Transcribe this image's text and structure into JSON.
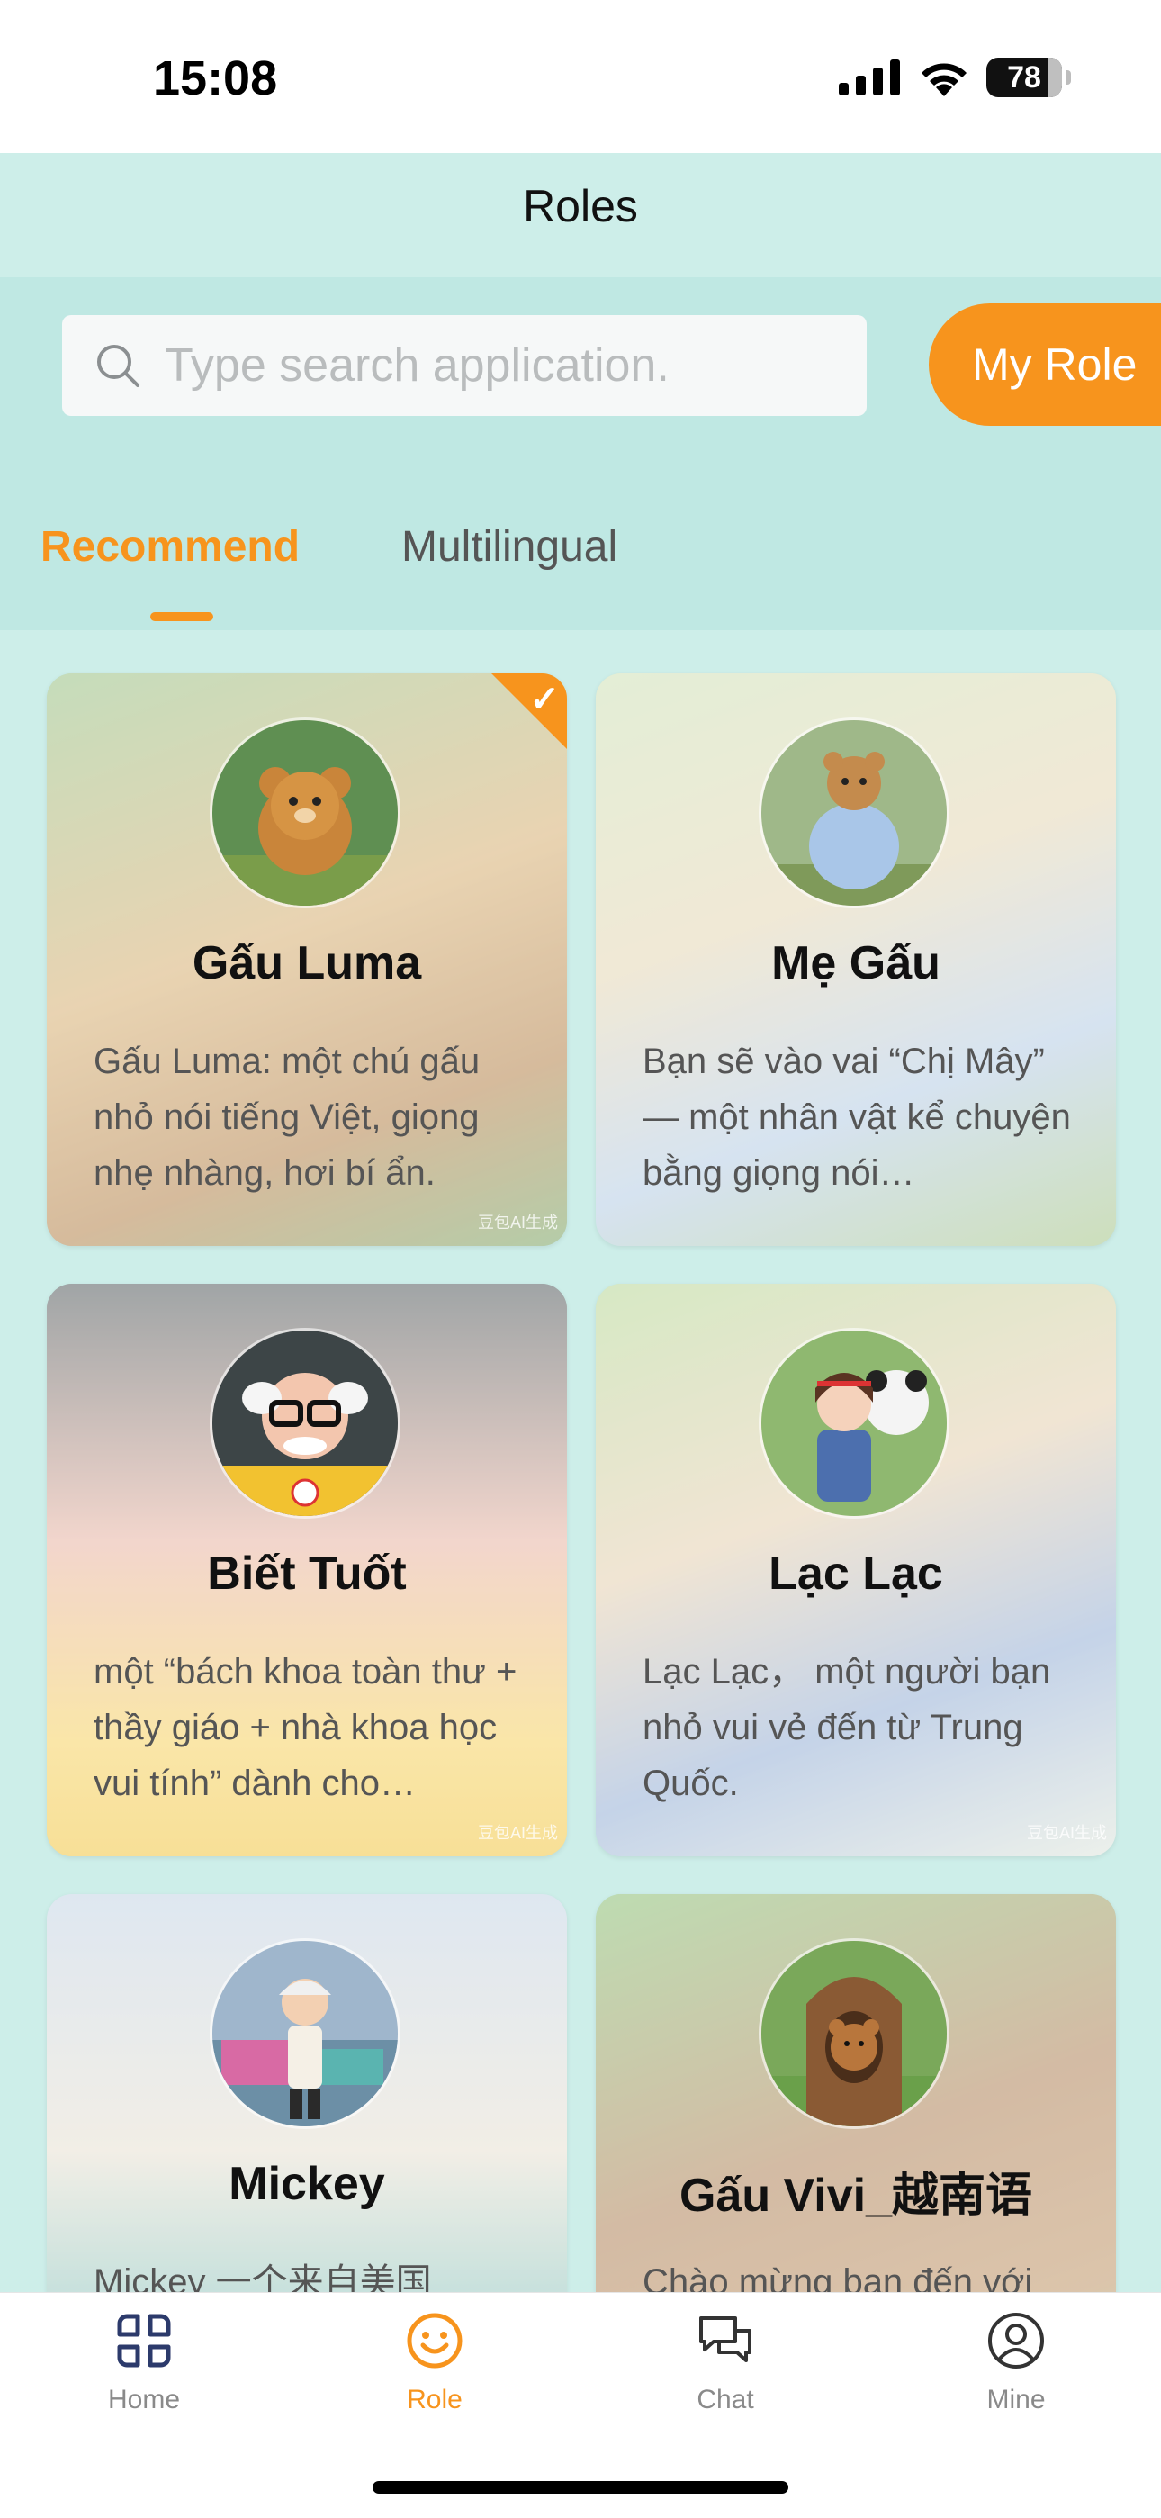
{
  "status_bar": {
    "time": "15:08",
    "battery": "78"
  },
  "header": {
    "title": "Roles"
  },
  "search": {
    "placeholder": "Type search application.",
    "icon": "search-icon"
  },
  "my_role_button": {
    "label": "My Role"
  },
  "tabs": [
    {
      "label": "Recommend",
      "active": true
    },
    {
      "label": "Multilingual",
      "active": false
    }
  ],
  "roles": [
    {
      "name": "Gấu Luma",
      "description": "Gấu Luma: một chú gấu nhỏ nói tiếng Việt, giọng nhẹ nhàng, hơi bí ẩn.",
      "selected": true,
      "watermark": "豆包AI生成"
    },
    {
      "name": "Mẹ Gấu",
      "description": "Bạn sẽ vào vai “Chị Mây” — một nhân vật kể chuyện bằng giọng nói…",
      "selected": false,
      "watermark": ""
    },
    {
      "name": "Biết Tuốt",
      "description": "một “bách khoa toàn thư + thầy giáo + nhà khoa học vui tính” dành cho…",
      "selected": false,
      "watermark": "豆包AI生成"
    },
    {
      "name": "Lạc Lạc",
      "description": "Lạc Lạc， một người bạn nhỏ vui vẻ đến từ Trung Quốc.",
      "selected": false,
      "watermark": "豆包AI生成"
    },
    {
      "name": "Mickey",
      "description": "Mickey 一个来自美国",
      "selected": false,
      "watermark": ""
    },
    {
      "name": "Gấu Vivi_越南语",
      "description": "Chào mừng bạn đến với",
      "selected": false,
      "watermark": ""
    }
  ],
  "bottom_nav": [
    {
      "label": "Home",
      "icon": "home-grid-icon",
      "active": false
    },
    {
      "label": "Role",
      "icon": "smiley-icon",
      "active": true
    },
    {
      "label": "Chat",
      "icon": "chat-bubbles-icon",
      "active": false
    },
    {
      "label": "Mine",
      "icon": "user-circle-icon",
      "active": false
    }
  ],
  "colors": {
    "accent": "#f7941d",
    "header_bg": "#bfe8e3",
    "page_bg": "#cdeee9",
    "nav_active": "#f7941d",
    "nav_inactive": "#8a8a8a",
    "nav_home_icon": "#2c3a6b"
  }
}
